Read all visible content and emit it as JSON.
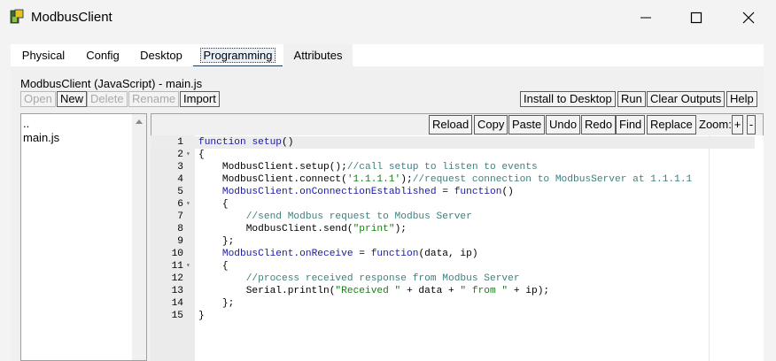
{
  "window": {
    "title": "ModbusClient",
    "controls": [
      "minimize-icon",
      "maximize-icon",
      "close-icon"
    ]
  },
  "tabs": [
    {
      "label": "Physical",
      "active": false
    },
    {
      "label": "Config",
      "active": false
    },
    {
      "label": "Desktop",
      "active": false
    },
    {
      "label": "Programming",
      "active": true
    },
    {
      "label": "Attributes",
      "active": false
    }
  ],
  "project": {
    "title": "ModbusClient (JavaScript) - main.js"
  },
  "toolbar": {
    "open": "Open",
    "new": "New",
    "delete": "Delete",
    "rename": "Rename",
    "import": "Import",
    "install": "Install to Desktop",
    "run": "Run",
    "clear": "Clear Outputs",
    "help": "Help"
  },
  "files": {
    "items": [
      "..",
      "main.js"
    ]
  },
  "editor_toolbar": {
    "reload": "Reload",
    "copy": "Copy",
    "paste": "Paste",
    "undo": "Undo",
    "redo": "Redo",
    "find": "Find",
    "replace": "Replace",
    "zoom_label": "Zoom:",
    "zoom_in": "+",
    "zoom_out": "-"
  },
  "code": {
    "lines": [
      {
        "n": "1",
        "fold": false,
        "html": "<span class=\"kw\">function</span> <span class=\"kw\">setup</span>()"
      },
      {
        "n": "2",
        "fold": true,
        "html": "{"
      },
      {
        "n": "3",
        "fold": false,
        "html": "    ModbusClient.setup();<span class=\"cm\">//call setup to listen to events</span>"
      },
      {
        "n": "4",
        "fold": false,
        "html": "    ModbusClient.connect(<span class=\"st\">'1.1.1.1'</span>);<span class=\"cm\">//request connection to ModbusServer at 1.1.1.1</span>"
      },
      {
        "n": "5",
        "fold": false,
        "html": "    <span class=\"kw\">ModbusClient.onConnectionEstablished</span> = <span class=\"kw\">function</span>()"
      },
      {
        "n": "6",
        "fold": true,
        "html": "    {"
      },
      {
        "n": "7",
        "fold": false,
        "html": "        <span class=\"cm\">//send Modbus request to Modbus Server</span>"
      },
      {
        "n": "8",
        "fold": false,
        "html": "        ModbusClient.send(<span class=\"st\">\"print\"</span>);"
      },
      {
        "n": "9",
        "fold": false,
        "html": "    };"
      },
      {
        "n": "10",
        "fold": false,
        "html": "    <span class=\"kw\">ModbusClient.onReceive</span> = <span class=\"kw\">function</span>(data, ip)"
      },
      {
        "n": "11",
        "fold": true,
        "html": "    {"
      },
      {
        "n": "12",
        "fold": false,
        "html": "        <span class=\"cm\">//process received response from Modbus Server</span>"
      },
      {
        "n": "13",
        "fold": false,
        "html": "        Serial.println(<span class=\"st\">\"Received \"</span> + data + <span class=\"st\">\" from \"</span> + ip);"
      },
      {
        "n": "14",
        "fold": false,
        "html": "    };"
      },
      {
        "n": "15",
        "fold": false,
        "html": "}"
      }
    ]
  }
}
